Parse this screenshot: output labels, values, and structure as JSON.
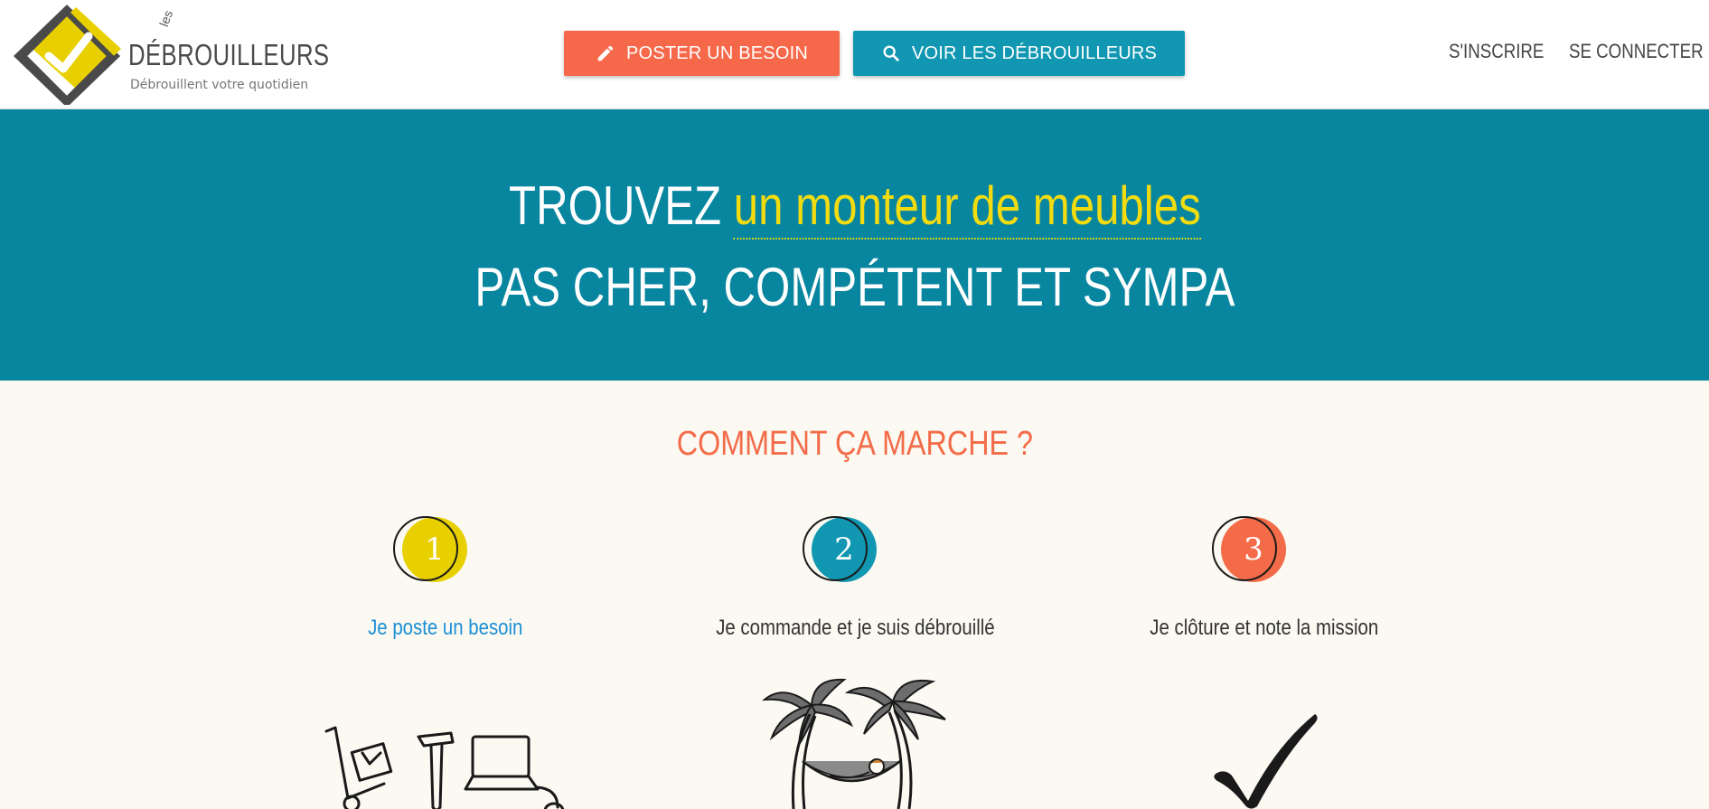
{
  "header": {
    "logo": {
      "small": "les",
      "name": "DÉBROUILLEURS",
      "tagline": "Débrouillent votre quotidien"
    },
    "buttons": {
      "post": "POSTER UN BESOIN",
      "see": "VOIR LES DÉBROUILLEURS"
    },
    "nav": {
      "signup": "S'INSCRIRE",
      "login": "SE CONNECTER"
    }
  },
  "hero": {
    "prefix": "TROUVEZ",
    "highlight": "un monteur de meubles",
    "line2": "PAS CHER, COMPÉTENT ET SYMPA"
  },
  "how": {
    "title": "COMMENT ÇA MARCHE ?",
    "steps": [
      {
        "number": "1",
        "label": "Je poste un besoin",
        "color": "#e8d000",
        "illustration": "tools-icons"
      },
      {
        "number": "2",
        "label": "Je commande et je suis débrouillé",
        "color": "#1197b2",
        "illustration": "hammock-palm-trees"
      },
      {
        "number": "3",
        "label": "Je clôture et note la mission",
        "color": "#f36b48",
        "illustration": "checkmark"
      }
    ]
  },
  "colors": {
    "accent_orange": "#f5694a",
    "accent_teal": "#1197b2",
    "hero_bg": "#08869f",
    "highlight_yellow": "#f2dc10",
    "page_bg": "#fbf9f2"
  }
}
